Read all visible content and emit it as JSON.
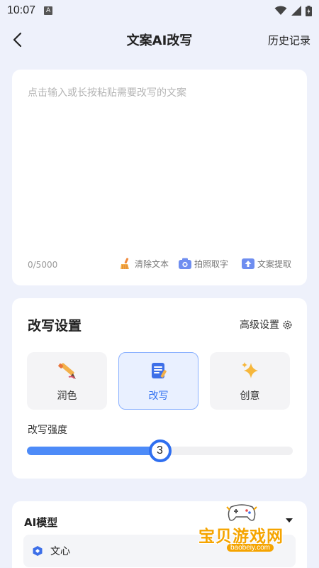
{
  "status_bar": {
    "time": "10:07",
    "notification_letter": "A"
  },
  "header": {
    "title": "文案AI改写",
    "history_label": "历史记录"
  },
  "input": {
    "placeholder": "点击输入或长按粘贴需要改写的文案",
    "value": "",
    "counter": "0/5000",
    "tools": [
      {
        "label": "清除文本",
        "icon": "broom-icon"
      },
      {
        "label": "拍照取字",
        "icon": "camera-icon"
      },
      {
        "label": "文案提取",
        "icon": "upload-icon"
      }
    ]
  },
  "settings": {
    "title": "改写设置",
    "advanced_label": "高级设置",
    "modes": [
      {
        "label": "润色",
        "icon": "pen-brush-icon",
        "selected": false
      },
      {
        "label": "改写",
        "icon": "document-edit-icon",
        "selected": true
      },
      {
        "label": "创意",
        "icon": "sparkle-icon",
        "selected": false
      }
    ],
    "strength_label": "改写强度",
    "strength_value": "3",
    "strength_fraction": 0.5
  },
  "model": {
    "title": "AI模型",
    "selected": "文心"
  },
  "watermark": {
    "text": "宝贝游戏网",
    "url": "baobeiy.com"
  },
  "colors": {
    "accent": "#2f6ff0",
    "background": "#eef1fb",
    "watermark": "#f5a400"
  }
}
